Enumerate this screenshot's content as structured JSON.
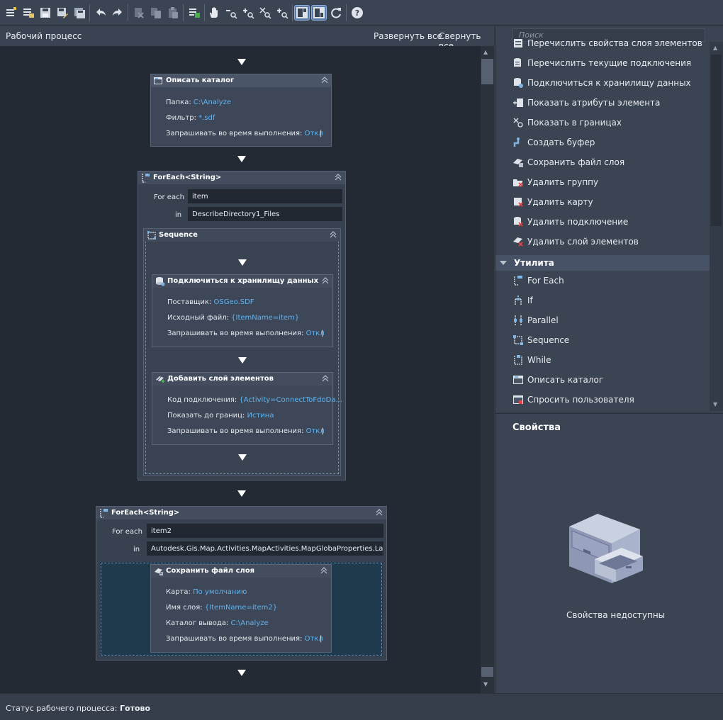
{
  "toolbar": {
    "icons": [
      "new-workflow-icon",
      "open-workflow-icon",
      "save-icon",
      "save-as-icon",
      "save-all-icon",
      "undo-icon",
      "redo-icon",
      "cut-icon",
      "copy-icon",
      "paste-icon",
      "run-icon",
      "pan-hand-icon",
      "zoom-out-icon",
      "zoom-in-icon",
      "zoom-fit-icon",
      "zoom-reset-icon",
      "layout-palette-icon",
      "layout-properties-icon",
      "refresh-icon",
      "help-icon"
    ]
  },
  "canvas_header": {
    "title": "Рабочий процесс",
    "expand_all": "Развернуть все",
    "collapse_all": "Свернуть все"
  },
  "describe_dir": {
    "title": "Описать каталог",
    "folder_label": "Папка:",
    "folder_value": "C:\\Analyze",
    "filter_label": "Фильтр:",
    "filter_value": "*.sdf",
    "prompt_label": "Запрашивать во время выполнения:",
    "prompt_value": "Откл"
  },
  "foreach1": {
    "title": "ForEach<String>",
    "for_each_label": "For each",
    "for_each_value": "item",
    "in_label": "in",
    "in_value": "DescribeDirectory1_Files",
    "sequence_title": "Sequence"
  },
  "connect": {
    "title": "Подключиться к хранилищу данных",
    "provider_label": "Поставщик:",
    "provider_value": "OSGeo.SDF",
    "source_label": "Исходный файл:",
    "source_value": "{ItemName=item}",
    "prompt_label": "Запрашивать во время выполнения:",
    "prompt_value": "Откл"
  },
  "add_layer": {
    "title": "Добавить слой элементов",
    "conn_label": "Код подключения:",
    "conn_value": "{Activity=ConnectToFdoDa...",
    "zoom_label": "Показать до границ:",
    "zoom_value": "Истина",
    "prompt_label": "Запрашивать во время выполнения:",
    "prompt_value": "Откл"
  },
  "foreach2": {
    "title": "ForEach<String>",
    "for_each_label": "For each",
    "for_each_value": "item2",
    "in_label": "in",
    "in_value": "Autodesk.Gis.Map.Activities.MapActivities.MapGlobaProperties.Layers"
  },
  "save_layer": {
    "title": "Сохранить файл слоя",
    "map_label": "Карта:",
    "map_value": "По умолчанию",
    "layer_label": "Имя слоя:",
    "layer_value": "{ItemName=item2}",
    "outdir_label": "Каталог вывода:",
    "outdir_value": "C:\\Analyze",
    "prompt_label": "Запрашивать во время выполнения:",
    "prompt_value": "Откл"
  },
  "status": {
    "label": "Статус рабочего процесса:",
    "value": "Готово"
  },
  "palette": {
    "search_placeholder": "Поиск",
    "items_top": [
      {
        "label": "Перечислить свойства слоя элементов",
        "icon": "list-layer-props-icon"
      },
      {
        "label": "Перечислить текущие подключения",
        "icon": "list-connections-icon"
      },
      {
        "label": "Подключиться к хранилищу данных",
        "icon": "connect-datastore-icon"
      },
      {
        "label": "Показать атрибуты элемента",
        "icon": "show-attributes-icon"
      },
      {
        "label": "Показать в границах",
        "icon": "zoom-extents-icon"
      },
      {
        "label": "Создать буфер",
        "icon": "create-buffer-icon"
      },
      {
        "label": "Сохранить файл слоя",
        "icon": "save-layer-icon"
      },
      {
        "label": "Удалить группу",
        "icon": "remove-group-icon"
      },
      {
        "label": "Удалить карту",
        "icon": "remove-map-icon"
      },
      {
        "label": "Удалить подключение",
        "icon": "remove-connection-icon"
      },
      {
        "label": "Удалить слой элементов",
        "icon": "remove-layer-icon"
      }
    ],
    "category": "Утилита",
    "items_util": [
      {
        "label": "For Each",
        "icon": "foreach-icon"
      },
      {
        "label": "If",
        "icon": "if-icon"
      },
      {
        "label": "Parallel",
        "icon": "parallel-icon"
      },
      {
        "label": "Sequence",
        "icon": "sequence-icon"
      },
      {
        "label": "While",
        "icon": "while-icon"
      },
      {
        "label": "Описать каталог",
        "icon": "describe-directory-icon"
      },
      {
        "label": "Спросить пользователя",
        "icon": "ask-user-icon"
      }
    ]
  },
  "properties": {
    "title": "Свойства",
    "unavailable": "Свойства недоступны"
  },
  "colors": {
    "link_value": "#5fb3f2",
    "canvas_bg": "#232a33",
    "panel_bg": "#3b4452"
  }
}
